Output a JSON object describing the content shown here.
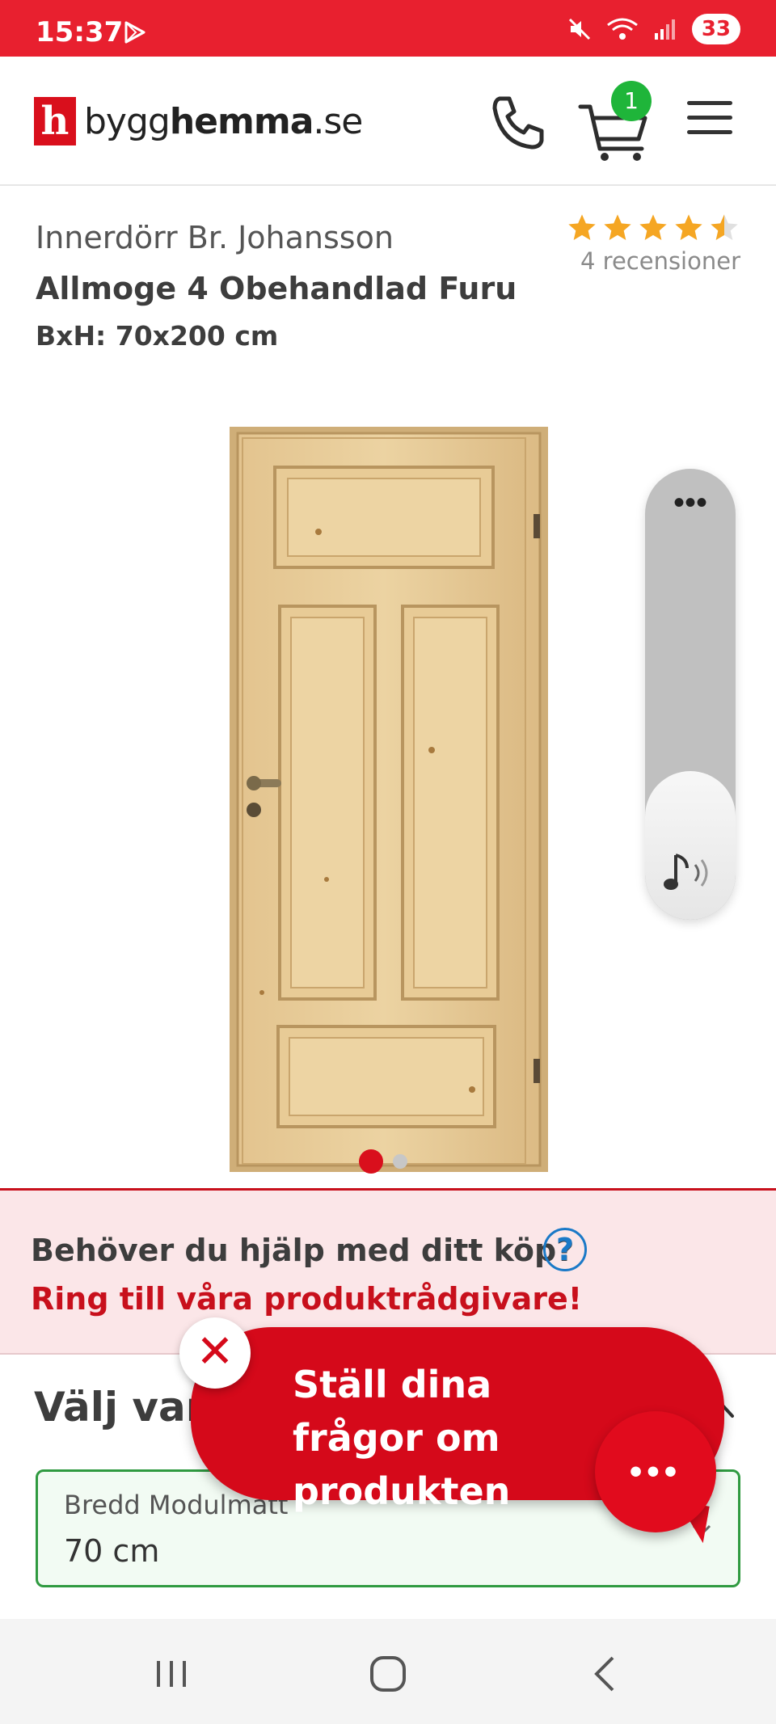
{
  "status_bar": {
    "time": "15:37",
    "battery": "33",
    "icons": [
      "play-store-icon",
      "mute-icon",
      "wifi-icon",
      "signal-icon"
    ]
  },
  "header": {
    "logo_letter": "h",
    "logo_text_light": "bygg",
    "logo_text_bold": "hemma",
    "logo_text_suffix": ".se",
    "cart_count": "1"
  },
  "product": {
    "brand_line": "Innerdörr Br. Johansson",
    "name": "Allmoge 4 Obehandlad Furu",
    "size": "BxH: 70x200 cm",
    "rating": 4.5,
    "reviews": "4 recensioner",
    "image_count": 2,
    "active_image": 1
  },
  "volume_overlay": {
    "more": "•••",
    "level": 0.33
  },
  "help_banner": {
    "question": "Behöver du hjälp med ditt köp?",
    "help_icon": "?",
    "cta": "Ring till våra produktrådgivare!"
  },
  "variant": {
    "title": "Välj variant",
    "field_label": "Bredd Modulmått",
    "field_value": "70 cm"
  },
  "chat": {
    "close": "✕",
    "message": "Ställ dina frågor om produkten",
    "fab_dots": "•••"
  },
  "colors": {
    "brand_red": "#d90f1c",
    "status_red": "#e8202f",
    "accent_green": "#2f9a40",
    "link_blue": "#1a79c7"
  }
}
